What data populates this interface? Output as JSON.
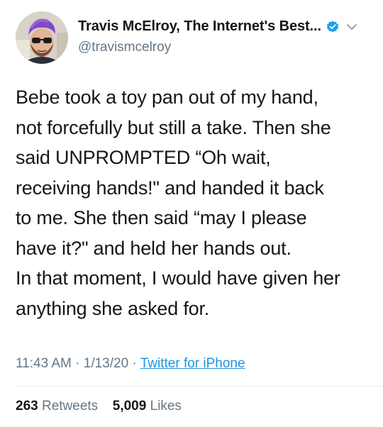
{
  "author": {
    "display_name": "Travis McElroy, The Internet's Best...",
    "handle": "@travismcelroy",
    "avatar_icon": "profile-photo",
    "verified_icon": "verified-badge-icon",
    "menu_icon": "chevron-down-icon"
  },
  "tweet": {
    "lines": [
      "Bebe took a toy pan out of my hand,",
      "not forcefully but still a take. Then she",
      "said UNPROMPTED “Oh wait,",
      "receiving hands!\" and handed it back",
      "to me. She then said “may I please",
      "have it?\" and held her hands out.",
      "In that moment, I would have given her",
      "anything she asked for."
    ]
  },
  "meta": {
    "time": "11:43 AM",
    "separator": "·",
    "date": "1/13/20",
    "source": "Twitter for iPhone"
  },
  "stats": {
    "retweets_count": "263",
    "retweets_label": "Retweets",
    "likes_count": "5,009",
    "likes_label": "Likes"
  },
  "colors": {
    "text": "#14171a",
    "secondary": "#657786",
    "link": "#1b95e0",
    "verified": "#1da1f2",
    "divider": "#e1e8ed"
  }
}
